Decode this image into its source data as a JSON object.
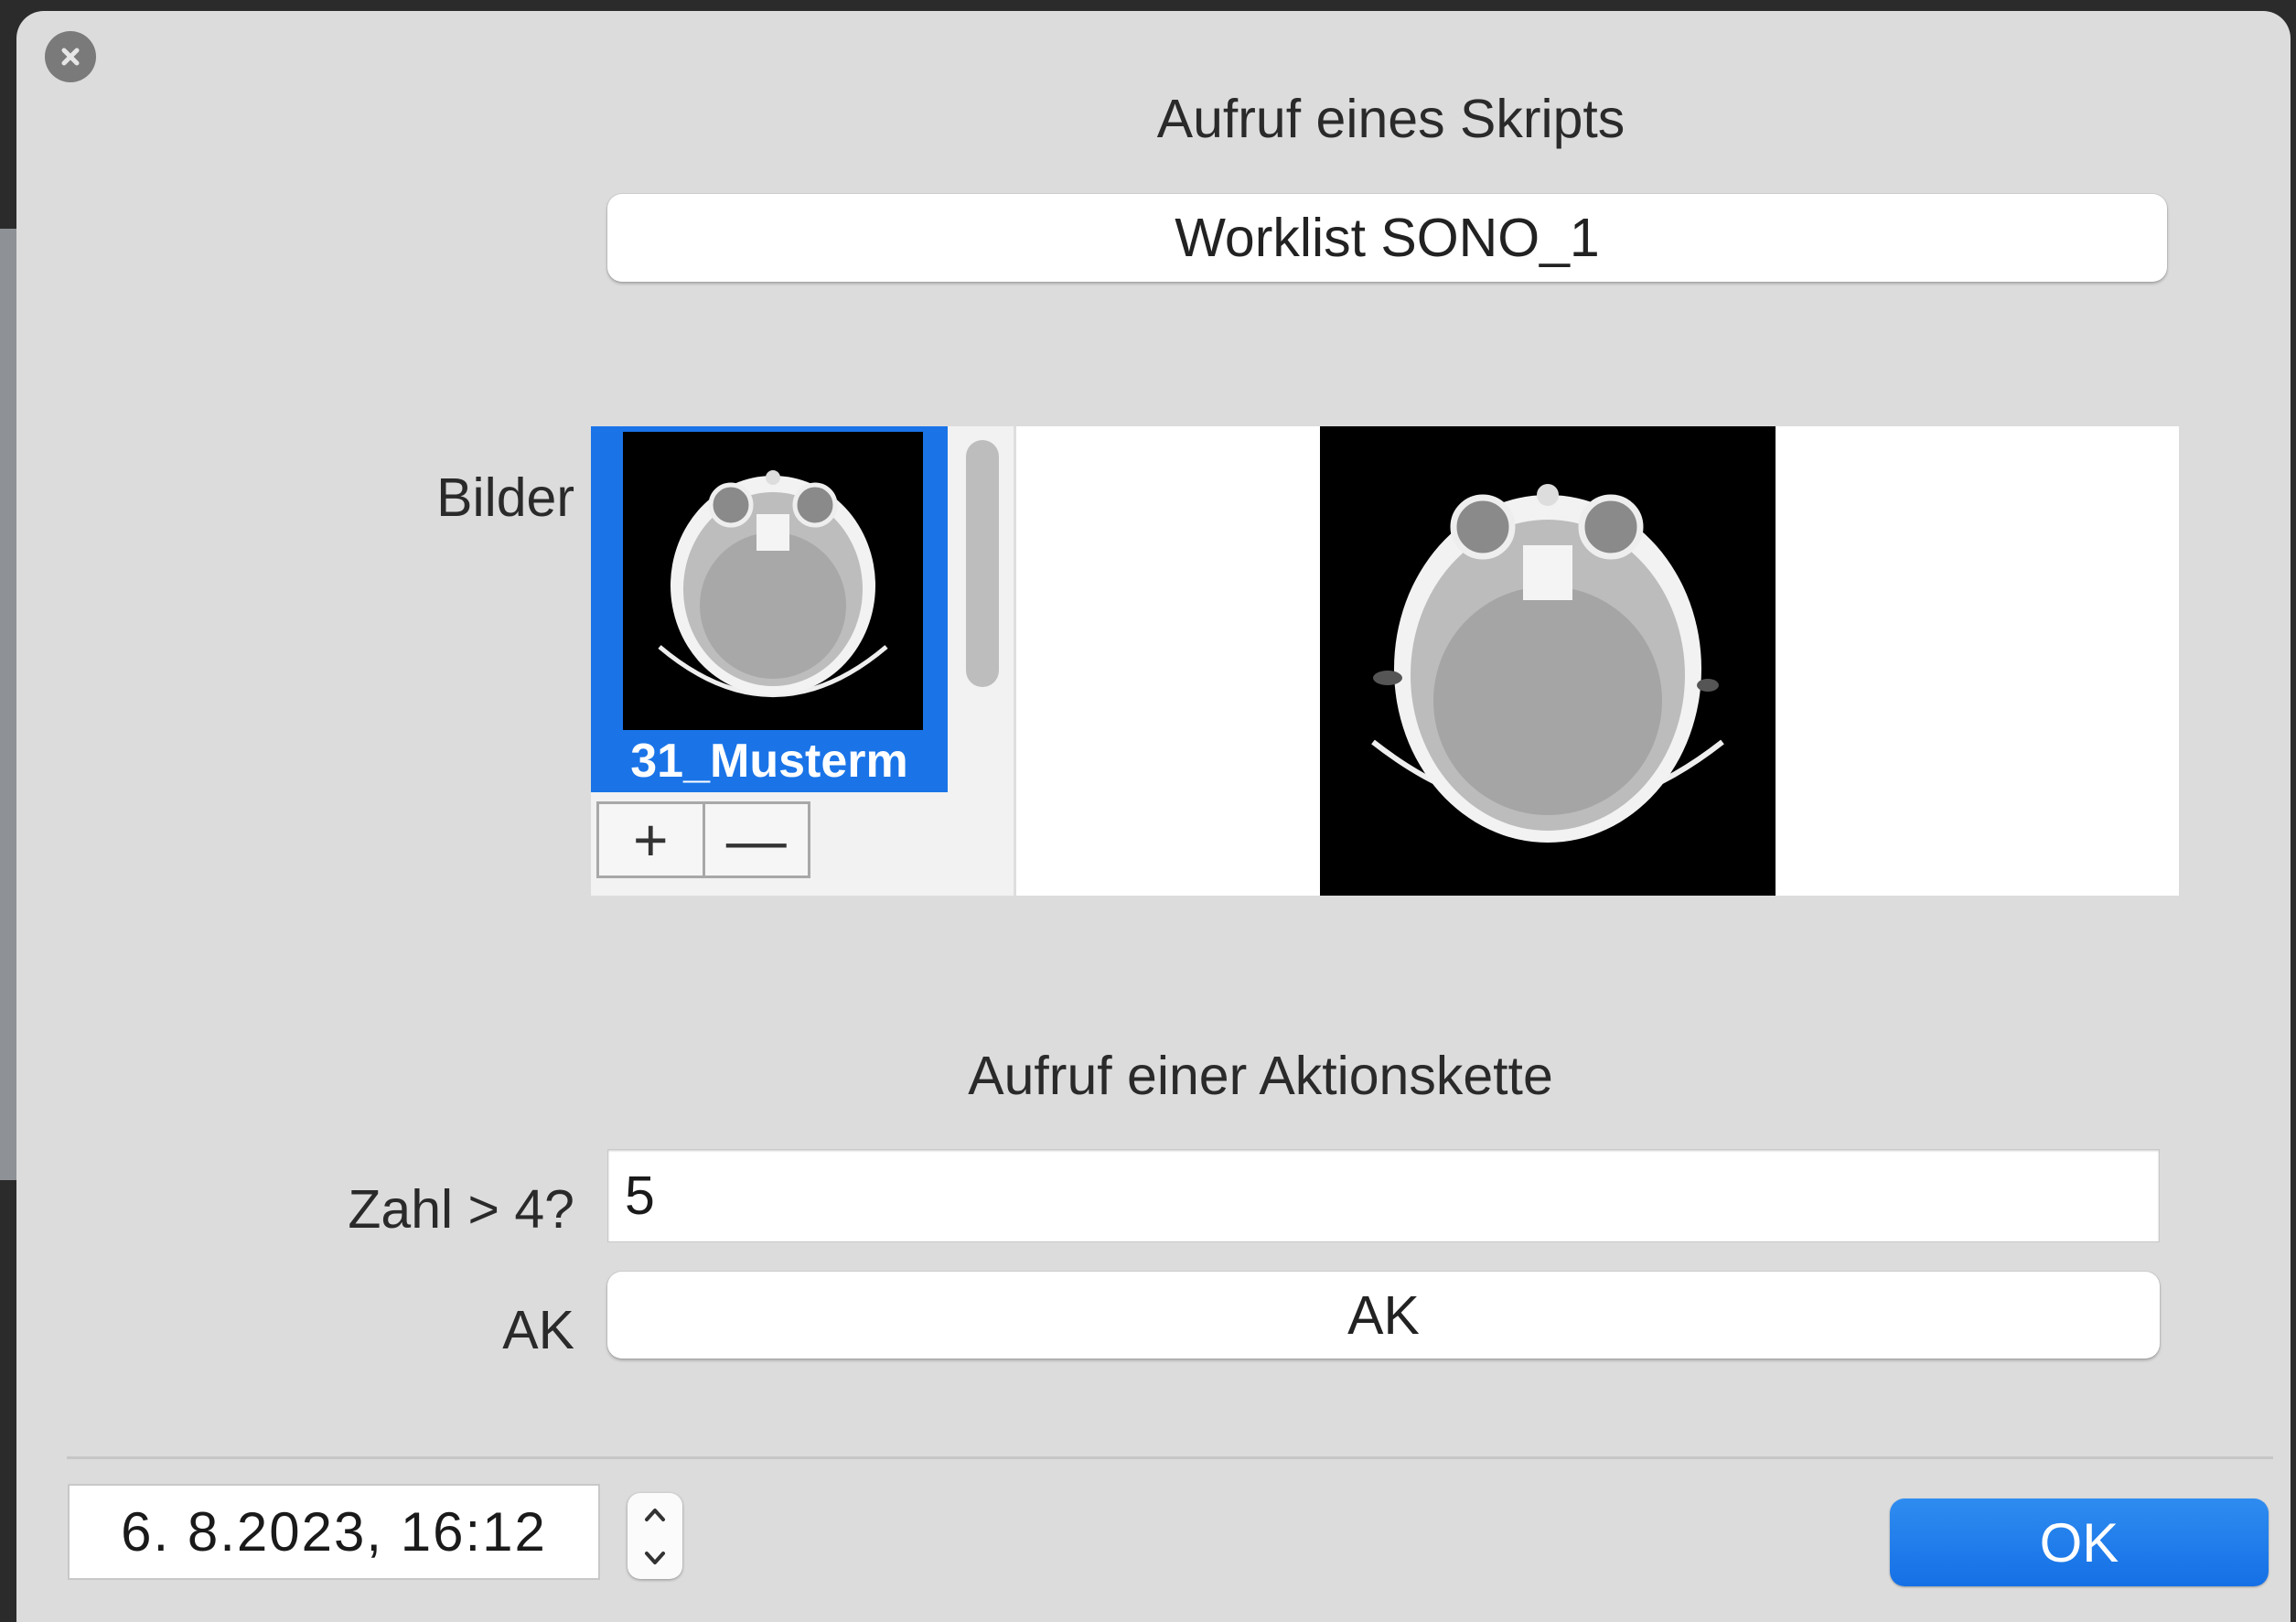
{
  "dialog": {
    "close_icon": "close-circle-icon",
    "script_heading": "Aufruf eines Skripts",
    "worklist_button": "Worklist SONO_1",
    "images_label": "Bilder",
    "thumbnail_caption": "31_Musterm",
    "add_symbol": "+",
    "remove_symbol": "—",
    "chain_heading": "Aufruf einer Aktionskette",
    "number_label": "Zahl > 4?",
    "number_value": "5",
    "ak_label": "AK",
    "ak_button": "AK",
    "date_value": "6.  8.2023, 16:12",
    "ok_button": "OK"
  },
  "colors": {
    "accent": "#1a74e8",
    "dialog_bg": "#dcdcdc",
    "ok_button": "#1570e6"
  }
}
